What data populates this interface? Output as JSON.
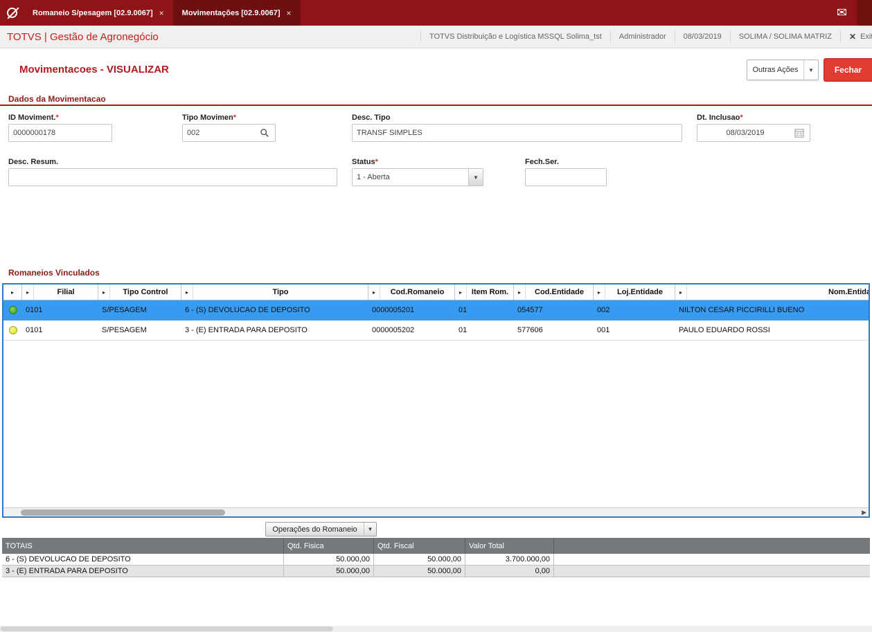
{
  "topbar": {
    "tabs": [
      {
        "label": "Romaneio S/pesagem [02.9.0067]",
        "active": false
      },
      {
        "label": "Movimentações [02.9.0067]",
        "active": true
      }
    ]
  },
  "header": {
    "brand": "TOTVS | Gestão de Agronegócio",
    "environment": "TOTVS Distribuição e Logística MSSQL Solima_tst",
    "user": "Administrador",
    "date": "08/03/2019",
    "company": "SOLIMA / SOLIMA MATRIZ",
    "exit": "Exit"
  },
  "page": {
    "title": "Movimentacoes - VISUALIZAR",
    "other_actions": "Outras Ações",
    "close_button": "Fechar"
  },
  "form": {
    "section_title": "Dados da Movimentacao",
    "required_mark": "*",
    "id_label": "ID Moviment.",
    "id_value": "0000000178",
    "tipo_label": "Tipo Movimen",
    "tipo_value": "002",
    "desc_tipo_label": "Desc. Tipo",
    "desc_tipo_value": "TRANSF SIMPLES",
    "dt_label": "Dt. Inclusao",
    "dt_value": "08/03/2019",
    "desc_resum_label": "Desc. Resum.",
    "desc_resum_value": "",
    "status_label": "Status",
    "status_value": "1 - Aberta",
    "fech_label": "Fech.Ser.",
    "fech_value": ""
  },
  "grid": {
    "section_title": "Romaneios Vinculados",
    "columns": [
      "Filial",
      "Tipo Control",
      "Tipo",
      "Cod.Romaneio",
      "Item Rom.",
      "Cod.Entidade",
      "Loj.Entidade",
      "Nom.Entidade"
    ],
    "rows": [
      {
        "status_color": "green",
        "filial": "0101",
        "tipo_control": "S/PESAGEM",
        "tipo": "6 - (S) DEVOLUCAO DE DEPOSITO",
        "cod_romaneio": "0000005201",
        "item_rom": "01",
        "cod_entidade": "054577",
        "loj_entidade": "002",
        "nom_entidade": "NILTON CESAR PICCIRILLI BUENO",
        "selected": true
      },
      {
        "status_color": "yellow",
        "filial": "0101",
        "tipo_control": "S/PESAGEM",
        "tipo": "3 - (E) ENTRADA PARA DEPOSITO",
        "cod_romaneio": "0000005202",
        "item_rom": "01",
        "cod_entidade": "577606",
        "loj_entidade": "001",
        "nom_entidade": "PAULO EDUARDO ROSSI",
        "selected": false
      }
    ],
    "operations_button": "Operações do Romaneio"
  },
  "totals": {
    "headers": [
      "TOTAIS",
      "Qtd. Fisica",
      "Qtd. Fiscal",
      "Valor Total"
    ],
    "rows": [
      {
        "label": "6 - (S) DEVOLUCAO DE DEPOSITO",
        "qtd_fisica": "50.000,00",
        "qtd_fiscal": "50.000,00",
        "valor_total": "3.700.000,00"
      },
      {
        "label": "3 - (E) ENTRADA PARA DEPOSITO",
        "qtd_fisica": "50.000,00",
        "qtd_fiscal": "50.000,00",
        "valor_total": "0,00"
      }
    ]
  },
  "icons": {
    "close": "×",
    "exit_x": "✕",
    "mail": "✉",
    "sort": "▸",
    "caret_down": "▼",
    "scroll_right": "▶"
  },
  "colors": {
    "topbar": "#8e1418",
    "active_tab": "#6d0e11",
    "accent_red": "#b3191e",
    "close_button": "#e23c32",
    "selection_blue": "#389bf2",
    "grid_border_blue": "#2b7bc9",
    "totals_header_gray": "#75797b",
    "status_green": "#3f9b1e",
    "status_yellow": "#dede2e"
  }
}
